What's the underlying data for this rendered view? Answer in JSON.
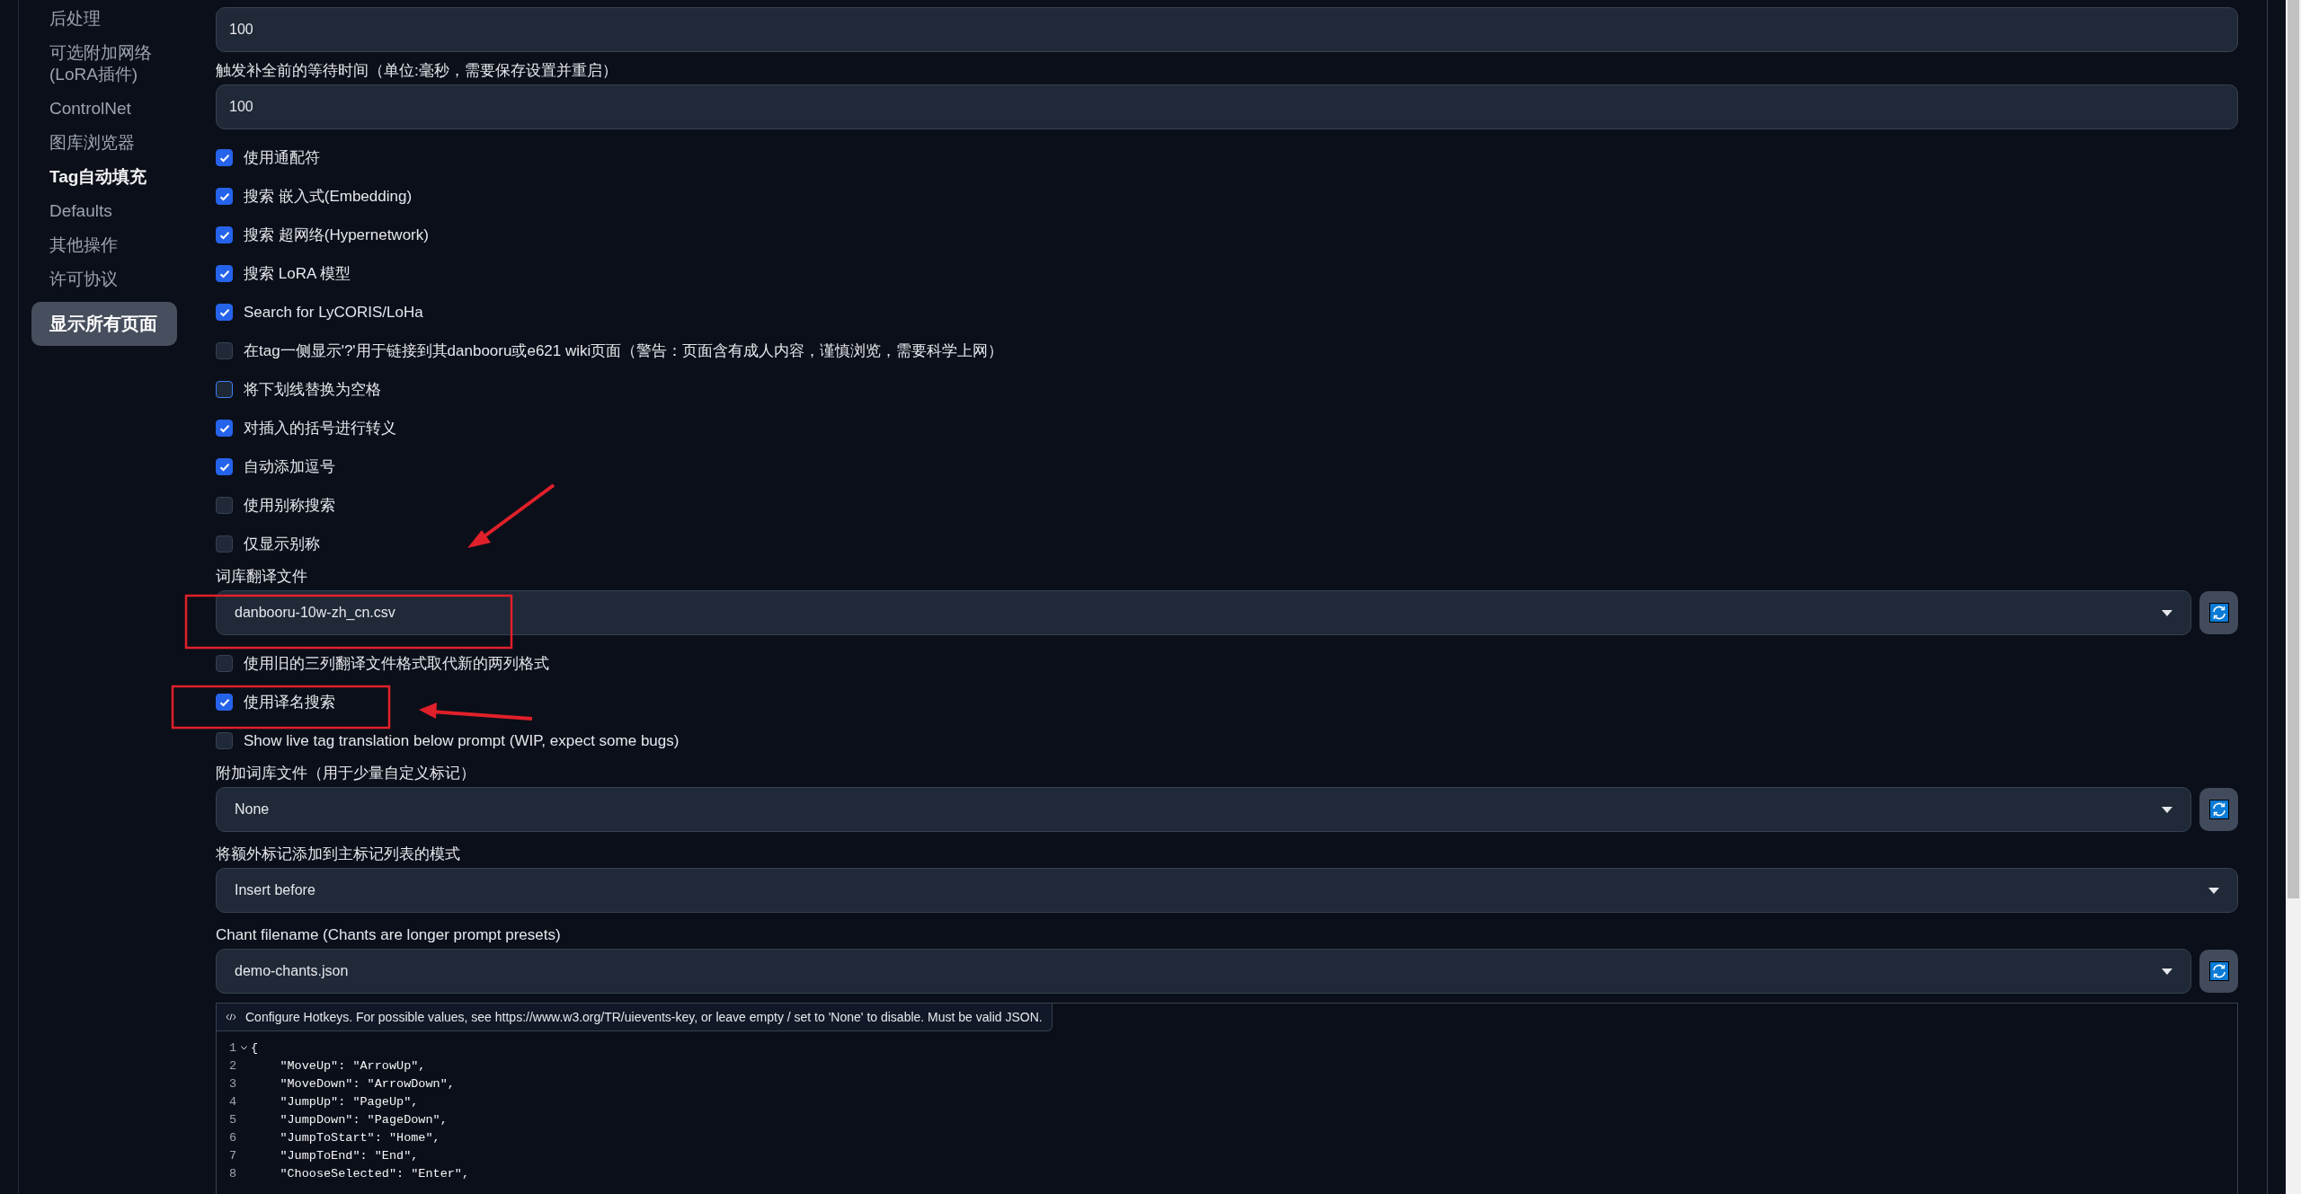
{
  "sidebar": {
    "items": [
      {
        "label": "后处理",
        "selected": false
      },
      {
        "label": "可选附加网络 (LoRA插件)",
        "selected": false
      },
      {
        "label": "ControlNet",
        "selected": false
      },
      {
        "label": "图库浏览器",
        "selected": false
      },
      {
        "label": "Tag自动填充",
        "selected": true
      },
      {
        "label": "Defaults",
        "selected": false
      },
      {
        "label": "其他操作",
        "selected": false
      },
      {
        "label": "许可协议",
        "selected": false
      }
    ],
    "show_all_button": "显示所有页面"
  },
  "settings": [
    {
      "kind": "number",
      "value": "100"
    },
    {
      "kind": "number",
      "label": "触发补全前的等待时间（单位:毫秒，需要保存设置并重启）",
      "value": "100"
    },
    {
      "kind": "checkbox",
      "label": "使用通配符",
      "checked": true
    },
    {
      "kind": "checkbox",
      "label": "搜索 嵌入式(Embedding)",
      "checked": true
    },
    {
      "kind": "checkbox",
      "label": "搜索 超网络(Hypernetwork)",
      "checked": true
    },
    {
      "kind": "checkbox",
      "label": "搜索 LoRA 模型",
      "checked": true
    },
    {
      "kind": "checkbox",
      "label": "Search for LyCORIS/LoHa",
      "checked": true
    },
    {
      "kind": "checkbox",
      "label": "在tag一侧显示'?'用于链接到其danbooru或e621 wiki页面（警告：页面含有成人内容，谨慎浏览，需要科学上网）",
      "checked": false
    },
    {
      "kind": "checkbox",
      "label": "将下划线替换为空格",
      "checked": false,
      "focus_ring": true
    },
    {
      "kind": "checkbox",
      "label": "对插入的括号进行转义",
      "checked": true
    },
    {
      "kind": "checkbox",
      "label": "自动添加逗号",
      "checked": true
    },
    {
      "kind": "checkbox",
      "label": "使用别称搜索",
      "checked": false
    },
    {
      "kind": "checkbox",
      "label": "仅显示别称",
      "checked": false
    },
    {
      "kind": "dropdown",
      "label": "词库翻译文件",
      "value": "danbooru-10w-zh_cn.csv",
      "refresh": true
    },
    {
      "kind": "checkbox",
      "label": "使用旧的三列翻译文件格式取代新的两列格式",
      "checked": false
    },
    {
      "kind": "checkbox",
      "label": "使用译名搜索",
      "checked": true
    },
    {
      "kind": "checkbox",
      "label": "Show live tag translation below prompt (WIP, expect some bugs)",
      "checked": false
    },
    {
      "kind": "dropdown",
      "label": "附加词库文件（用于少量自定义标记）",
      "value": "None",
      "refresh": true
    },
    {
      "kind": "dropdown",
      "label": "将额外标记添加到主标记列表的模式",
      "value": "Insert before",
      "refresh": false
    },
    {
      "kind": "dropdown",
      "label": "Chant filename (Chants are longer prompt presets)",
      "value": "demo-chants.json",
      "refresh": true
    },
    {
      "kind": "code",
      "caption": "Configure Hotkeys. For possible values, see https://www.w3.org/TR/uievents-key, or leave empty / set to 'None' to disable. Must be valid JSON.",
      "lines": [
        {
          "number": "1",
          "text": "{",
          "fold_marker": true
        },
        {
          "number": "2",
          "text": "    \"MoveUp\": \"ArrowUp\","
        },
        {
          "number": "3",
          "text": "    \"MoveDown\": \"ArrowDown\","
        },
        {
          "number": "4",
          "text": "    \"JumpUp\": \"PageUp\","
        },
        {
          "number": "5",
          "text": "    \"JumpDown\": \"PageDown\","
        },
        {
          "number": "6",
          "text": "    \"JumpToStart\": \"Home\","
        },
        {
          "number": "7",
          "text": "    \"JumpToEnd\": \"End\","
        },
        {
          "number": "8",
          "text": "    \"ChooseSelected\": \"Enter\","
        }
      ]
    }
  ]
}
